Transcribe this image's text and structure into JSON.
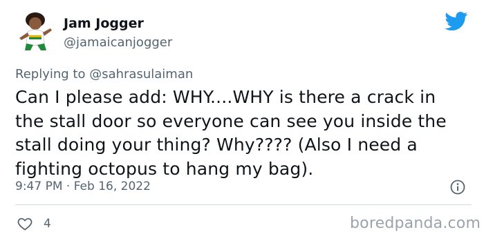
{
  "author": {
    "name": "Jam Jogger",
    "handle": "@jamaicanjogger"
  },
  "reply": {
    "prefix": "Replying to",
    "user": "@sahrasulaiman"
  },
  "tweet": {
    "line1": "Can I please add: WHY....WHY is there a crack in",
    "line2": "the stall door so everyone can see you inside the",
    "line3": "stall doing your thing? Why???? (Also I need a",
    "line4": "fighting octopus to hang my bag).",
    "timestamp": "9:47 PM · Feb 16, 2022"
  },
  "engagement": {
    "likes": "4"
  },
  "watermark": "boredpanda.com",
  "colors": {
    "twitter_blue": "#1d9bf0",
    "secondary_text": "#536471",
    "primary_text": "#0f1419",
    "divider": "#cfd9de"
  },
  "icons": {
    "logo": "twitter-bird-icon",
    "info": "info-icon",
    "like": "heart-icon"
  }
}
